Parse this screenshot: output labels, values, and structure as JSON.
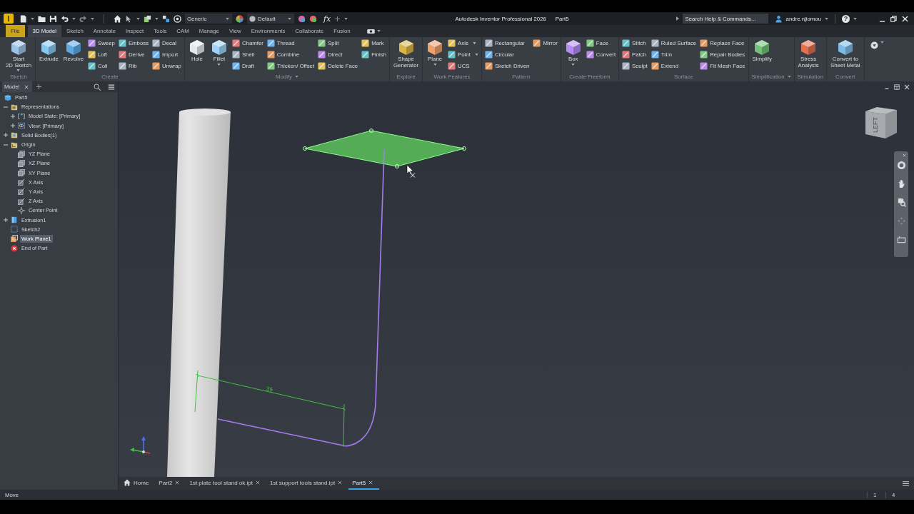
{
  "title_bar": {
    "app_logo": "I",
    "appearance": "Generic",
    "material": "Default",
    "fx_button": "fx",
    "title": "Autodesk Inventor Professional 2026",
    "document": "Part5",
    "search": {
      "placeholder": "Search Help & Commands..."
    },
    "user": "andre.njiomou",
    "help": "?"
  },
  "ribbon_tabs": [
    {
      "label": "File",
      "kind": "file",
      "selected": false
    },
    {
      "label": "3D Model",
      "kind": "tab",
      "selected": true
    },
    {
      "label": "Sketch",
      "kind": "tab",
      "selected": false
    },
    {
      "label": "Annotate",
      "kind": "tab",
      "selected": false
    },
    {
      "label": "Inspect",
      "kind": "tab",
      "selected": false
    },
    {
      "label": "Tools",
      "kind": "tab",
      "selected": false
    },
    {
      "label": "CAM",
      "kind": "tab",
      "selected": false
    },
    {
      "label": "Manage",
      "kind": "tab",
      "selected": false
    },
    {
      "label": "View",
      "kind": "tab",
      "selected": false
    },
    {
      "label": "Environments",
      "kind": "tab",
      "selected": false
    },
    {
      "label": "Collaborate",
      "kind": "tab",
      "selected": false
    },
    {
      "label": "Fusion",
      "kind": "tab",
      "selected": false
    }
  ],
  "ribbon_panels": [
    {
      "title": "Sketch",
      "menu": false,
      "large": [
        {
          "label": "Start\n2D Sketch",
          "dropdown": true
        }
      ]
    },
    {
      "title": "Create",
      "menu": false,
      "large": [
        {
          "label": "Extrude",
          "dropdown": false
        },
        {
          "label": "Revolve",
          "dropdown": false
        }
      ],
      "columns": [
        [
          {
            "label": "Sweep",
            "dropdown": false
          },
          {
            "label": "Loft",
            "dropdown": false
          },
          {
            "label": "Coil",
            "dropdown": false
          }
        ],
        [
          {
            "label": "Emboss",
            "dropdown": false
          },
          {
            "label": "Derive",
            "dropdown": false
          },
          {
            "label": "Rib",
            "dropdown": false
          }
        ],
        [
          {
            "label": "Decal",
            "dropdown": false
          },
          {
            "label": "Import",
            "dropdown": false
          },
          {
            "label": "Unwrap",
            "dropdown": false
          }
        ]
      ]
    },
    {
      "title": "Modify",
      "menu": true,
      "large": [
        {
          "label": "Hole",
          "dropdown": false
        },
        {
          "label": "Fillet",
          "dropdown": true
        }
      ],
      "columns": [
        [
          {
            "label": "Chamfer",
            "dropdown": false
          },
          {
            "label": "Shell",
            "dropdown": false
          },
          {
            "label": "Draft",
            "dropdown": false
          }
        ],
        [
          {
            "label": "Thread",
            "dropdown": false
          },
          {
            "label": "Combine",
            "dropdown": false
          },
          {
            "label": "Thicken/ Offset",
            "dropdown": false
          }
        ],
        [
          {
            "label": "Split",
            "dropdown": false
          },
          {
            "label": "Direct",
            "dropdown": false
          },
          {
            "label": "Delete Face",
            "dropdown": false
          }
        ],
        [
          {
            "label": "Mark",
            "dropdown": false
          },
          {
            "label": "Finish",
            "dropdown": false
          }
        ]
      ]
    },
    {
      "title": "Explore",
      "menu": false,
      "large": [
        {
          "label": "Shape\nGenerator",
          "dropdown": false
        }
      ]
    },
    {
      "title": "Work Features",
      "menu": false,
      "large": [
        {
          "label": "Plane",
          "dropdown": true
        }
      ],
      "columns": [
        [
          {
            "label": "Axis",
            "dropdown": true
          },
          {
            "label": "Point",
            "dropdown": true
          },
          {
            "label": "UCS",
            "dropdown": false
          }
        ]
      ]
    },
    {
      "title": "Pattern",
      "menu": false,
      "columns": [
        [
          {
            "label": "Rectangular",
            "dropdown": false
          },
          {
            "label": "Circular",
            "dropdown": false
          },
          {
            "label": "Sketch Driven",
            "dropdown": false
          }
        ],
        [
          {
            "label": "Mirror",
            "dropdown": false
          }
        ]
      ]
    },
    {
      "title": "Create Freeform",
      "menu": false,
      "large": [
        {
          "label": "Box",
          "dropdown": true
        }
      ],
      "columns": [
        [
          {
            "label": "Face",
            "dropdown": false
          },
          {
            "label": "Convert",
            "dropdown": false
          }
        ]
      ]
    },
    {
      "title": "Surface",
      "menu": false,
      "columns": [
        [
          {
            "label": "Stitch",
            "dropdown": false
          },
          {
            "label": "Patch",
            "dropdown": false
          },
          {
            "label": "Sculpt",
            "dropdown": false
          }
        ],
        [
          {
            "label": "Ruled Surface",
            "dropdown": false
          },
          {
            "label": "Trim",
            "dropdown": false
          },
          {
            "label": "Extend",
            "dropdown": false
          }
        ],
        [
          {
            "label": "Replace Face",
            "dropdown": false
          },
          {
            "label": "Repair Bodies",
            "dropdown": false
          },
          {
            "label": "Fit Mesh Face",
            "dropdown": false
          }
        ]
      ]
    },
    {
      "title": "Simplification",
      "menu": true,
      "large": [
        {
          "label": "Simplify",
          "dropdown": false
        }
      ]
    },
    {
      "title": "Simulation",
      "menu": false,
      "large": [
        {
          "label": "Stress\nAnalysis",
          "dropdown": false
        }
      ]
    },
    {
      "title": "Convert",
      "menu": false,
      "large": [
        {
          "label": "Convert to\nSheet Metal",
          "dropdown": false
        }
      ]
    }
  ],
  "browser": {
    "tab": "Model",
    "tree": [
      {
        "label": "Part5",
        "kind": "part",
        "selected": false,
        "children": [
          {
            "label": "Representations",
            "kind": "folder",
            "selected": false,
            "expanded": true,
            "children": [
              {
                "label": "Model State: [Primary]",
                "kind": "model_state",
                "selected": false,
                "expanded": false
              },
              {
                "label": "View: [Primary]",
                "kind": "view",
                "selected": false,
                "expanded": false
              }
            ]
          },
          {
            "label": "Solid Bodies(1)",
            "kind": "bodies",
            "selected": false,
            "expanded": false
          },
          {
            "label": "Origin",
            "kind": "origin",
            "selected": false,
            "expanded": true,
            "children": [
              {
                "label": "YZ Plane",
                "kind": "plane",
                "selected": false
              },
              {
                "label": "XZ Plane",
                "kind": "plane",
                "selected": false
              },
              {
                "label": "XY Plane",
                "kind": "plane",
                "selected": false
              },
              {
                "label": "X Axis",
                "kind": "axis",
                "selected": false
              },
              {
                "label": "Y Axis",
                "kind": "axis",
                "selected": false
              },
              {
                "label": "Z Axis",
                "kind": "axis",
                "selected": false
              },
              {
                "label": "Center Point",
                "kind": "point",
                "selected": false
              }
            ]
          },
          {
            "label": "Extrusion1",
            "kind": "extrusion",
            "selected": false,
            "expanded": false
          },
          {
            "label": "Sketch2",
            "kind": "sketch",
            "selected": false
          },
          {
            "label": "Work Plane1",
            "kind": "work_plane",
            "selected": true
          },
          {
            "label": "End of Part",
            "kind": "end",
            "selected": false
          }
        ]
      }
    ]
  },
  "viewport": {
    "dimension": "35",
    "view_cube_face": "LEFT"
  },
  "document_tabs": [
    {
      "label": "Home",
      "kind": "home",
      "selected": false
    },
    {
      "label": "Part2",
      "kind": "document",
      "selected": false
    },
    {
      "label": "1st plate tool stand ok.ipt",
      "kind": "document",
      "selected": false
    },
    {
      "label": "1st support tools stand.ipt",
      "kind": "document",
      "selected": false
    },
    {
      "label": "Part5",
      "kind": "document",
      "selected": true
    }
  ],
  "status_bar": {
    "message": "Move",
    "counts": [
      "1",
      "4"
    ]
  }
}
